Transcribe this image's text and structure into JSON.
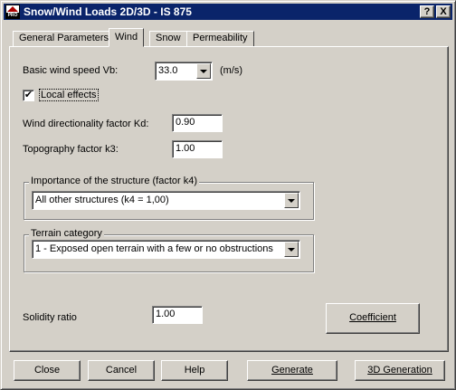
{
  "window": {
    "title": "Snow/Wind Loads 2D/3D - IS 875",
    "app_icon_text": "PRO",
    "help_button": "?",
    "close_button": "X"
  },
  "tabs": [
    {
      "label": "General Parameters",
      "active": false
    },
    {
      "label": "Wind",
      "active": true
    },
    {
      "label": "Snow",
      "active": false
    },
    {
      "label": "Permeability",
      "active": false
    }
  ],
  "wind": {
    "basic_speed_label": "Basic wind speed Vb:",
    "basic_speed_value": "33.0",
    "basic_speed_unit": "(m/s)",
    "local_effects_label": "Local effects",
    "local_effects_checked": "✔",
    "kd_label": "Wind directionality factor Kd:",
    "kd_value": "0.90",
    "k3_label": "Topography factor k3:",
    "k3_value": "1.00"
  },
  "importance": {
    "group_title": "Importance of the structure (factor k4)",
    "selected": "All other structures (k4 = 1,00)"
  },
  "terrain": {
    "group_title": "Terrain category",
    "selected": "1 - Exposed open terrain with a few or no obstructions"
  },
  "solidity": {
    "label": "Solidity ratio",
    "value": "1.00",
    "coefficient_button": "Coefficient"
  },
  "footer": {
    "close": "Close",
    "cancel": "Cancel",
    "help": "Help",
    "generate": "Generate",
    "generation_3d": "3D Generation"
  }
}
